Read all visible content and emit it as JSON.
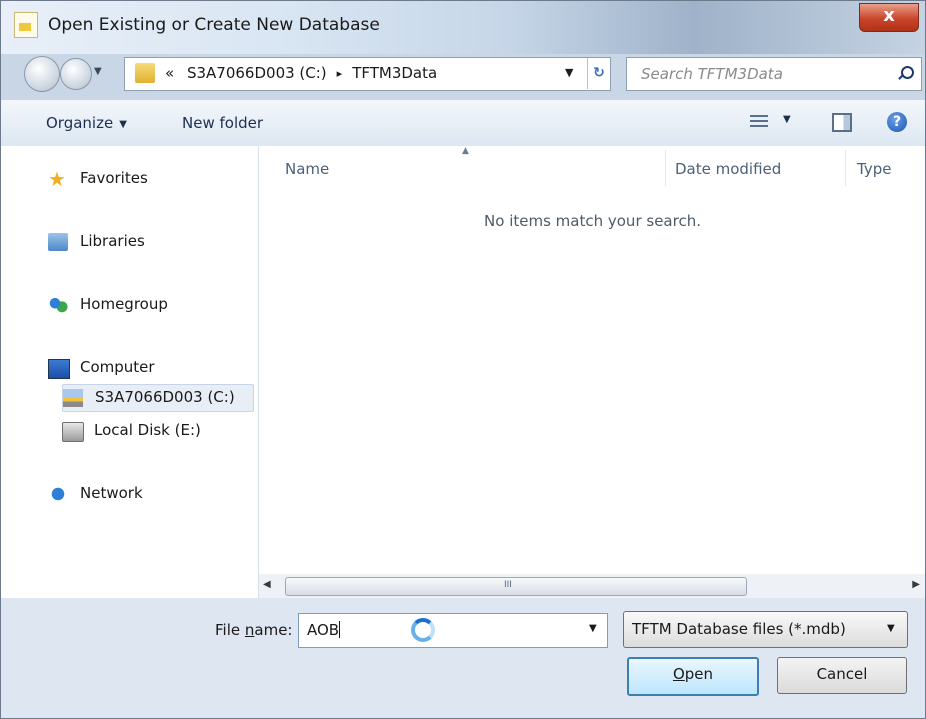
{
  "window": {
    "title": "Open Existing or Create New Database",
    "close_label": "x"
  },
  "address": {
    "overflow": "«",
    "crumbs": [
      "S3A7066D003 (C:)",
      "TFTM3Data"
    ],
    "separator": "▸"
  },
  "search": {
    "placeholder": "Search TFTM3Data"
  },
  "toolbar": {
    "organize_label": "Organize",
    "new_folder_label": "New folder"
  },
  "nav": {
    "favorites": "Favorites",
    "libraries": "Libraries",
    "homegroup": "Homegroup",
    "computer": "Computer",
    "drive_c": "S3A7066D003 (C:)",
    "drive_e": "Local Disk (E:)",
    "network": "Network"
  },
  "filelist": {
    "columns": [
      "Name",
      "Date modified",
      "Type"
    ],
    "empty_message": "No items match your search."
  },
  "scrollbar": {
    "grip": "III"
  },
  "bottom": {
    "filename_label_pre": "File ",
    "filename_label_u": "n",
    "filename_label_post": "ame:",
    "filename_value": "AOB",
    "filetype_value": "TFTM Database files (*.mdb)",
    "open_u": "O",
    "open_rest": "pen",
    "cancel_label": "Cancel"
  }
}
